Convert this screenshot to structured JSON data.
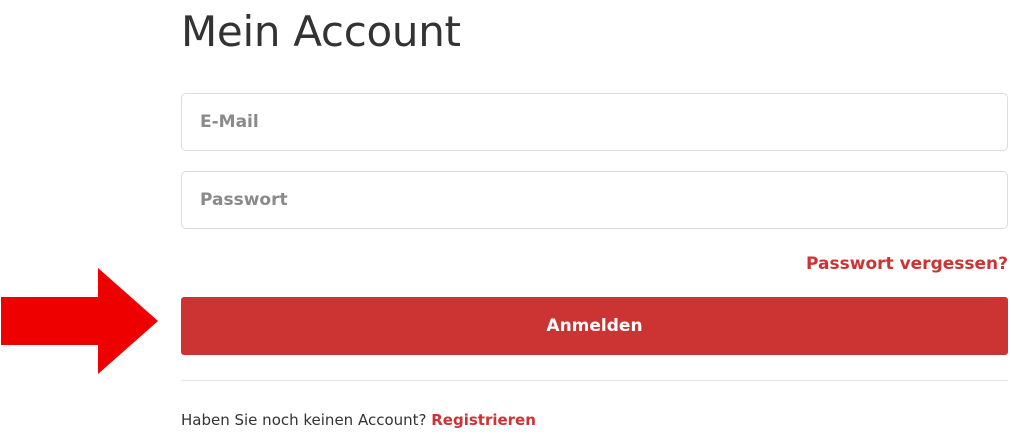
{
  "page": {
    "title": "Mein Account"
  },
  "form": {
    "email_placeholder": "E-Mail",
    "password_placeholder": "Passwort",
    "forgot_password_label": "Passwort vergessen?",
    "login_label": "Anmelden"
  },
  "register": {
    "prompt": "Haben Sie noch keinen Account? ",
    "link_label": "Registrieren"
  },
  "colors": {
    "accent": "#cc3333",
    "arrow": "#ee0000",
    "text": "#333333",
    "border": "#dcdcdc"
  },
  "icons": {
    "annotation_arrow": "right-arrow-icon"
  }
}
